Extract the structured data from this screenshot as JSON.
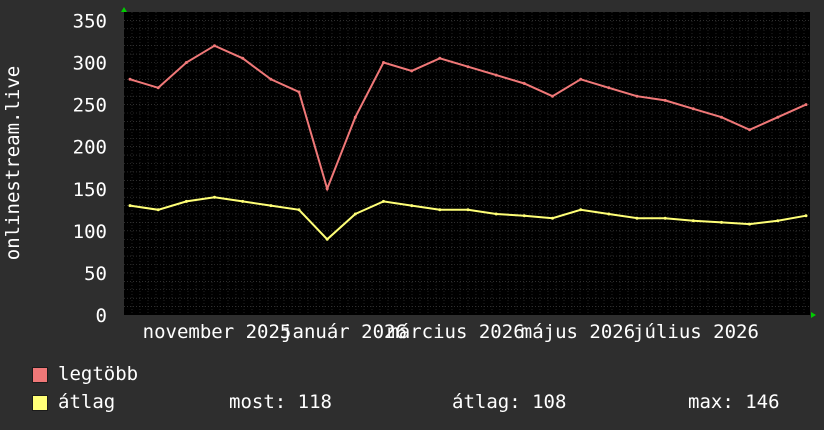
{
  "chart_data": {
    "type": "line",
    "ylabel": "onlinestream.live",
    "ylim": [
      0,
      360
    ],
    "yticks": [
      0,
      50,
      100,
      150,
      200,
      250,
      300,
      350
    ],
    "xticks": [
      "november 2025",
      "január 2026",
      "március 2026",
      "május 2026",
      "július 2026"
    ],
    "grid": true,
    "series": [
      {
        "name": "legtöbb",
        "color": "#f07878",
        "x": [
          "2025-10-05",
          "2025-10-19",
          "2025-11-02",
          "2025-11-16",
          "2025-11-30",
          "2025-12-14",
          "2025-12-28",
          "2026-01-11",
          "2026-01-25",
          "2026-02-08",
          "2026-02-22",
          "2026-03-08",
          "2026-03-22",
          "2026-04-05",
          "2026-04-19",
          "2026-05-03",
          "2026-05-17",
          "2026-05-31",
          "2026-06-14",
          "2026-06-28",
          "2026-07-12",
          "2026-07-26",
          "2026-08-09",
          "2026-08-23",
          "2026-09-06"
        ],
        "values": [
          280,
          270,
          300,
          320,
          305,
          280,
          265,
          150,
          235,
          300,
          290,
          305,
          295,
          285,
          275,
          260,
          280,
          270,
          260,
          255,
          245,
          235,
          220,
          235,
          250
        ]
      },
      {
        "name": "átlag",
        "color": "#ffff77",
        "x": [
          "2025-10-05",
          "2025-10-19",
          "2025-11-02",
          "2025-11-16",
          "2025-11-30",
          "2025-12-14",
          "2025-12-28",
          "2026-01-11",
          "2026-01-25",
          "2026-02-08",
          "2026-02-22",
          "2026-03-08",
          "2026-03-22",
          "2026-04-05",
          "2026-04-19",
          "2026-05-03",
          "2026-05-17",
          "2026-05-31",
          "2026-06-14",
          "2026-06-28",
          "2026-07-12",
          "2026-07-26",
          "2026-08-09",
          "2026-08-23",
          "2026-09-06"
        ],
        "values": [
          130,
          125,
          135,
          140,
          135,
          130,
          125,
          90,
          120,
          135,
          130,
          125,
          125,
          120,
          118,
          115,
          125,
          120,
          115,
          115,
          112,
          110,
          108,
          112,
          118
        ]
      }
    ]
  },
  "legend": {
    "max_label": "legtöbb",
    "avg_label": "átlag",
    "now": "most: 118",
    "avg": "átlag: 108",
    "max": "max: 146"
  },
  "colors": {
    "background": "#2e2e2e",
    "plot": "#000000",
    "grid": "#505050",
    "axis_arrow": "#00cc00"
  }
}
